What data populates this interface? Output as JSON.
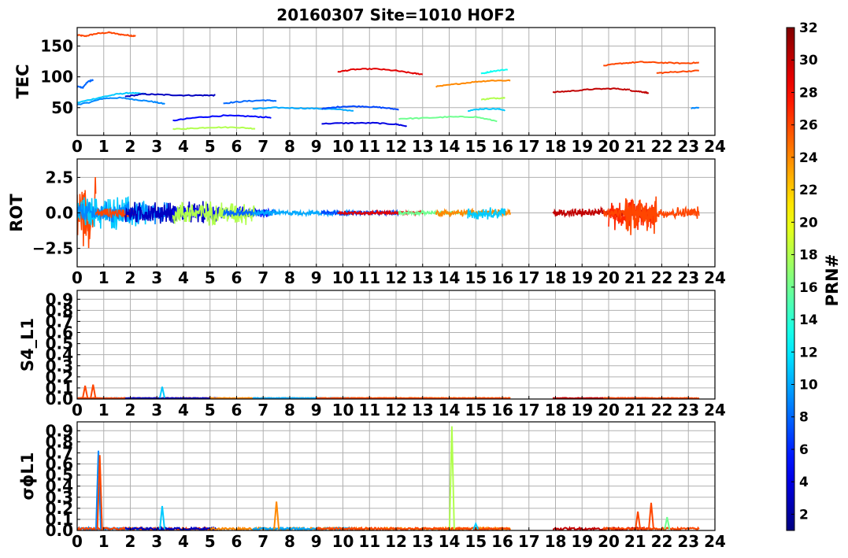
{
  "chart_data": {
    "title": "20160307 Site=1010 HOF2",
    "type": "line",
    "x_ticks": [
      "0",
      "1",
      "2",
      "3",
      "4",
      "5",
      "6",
      "7",
      "8",
      "9",
      "10",
      "11",
      "12",
      "13",
      "14",
      "15",
      "16",
      "17",
      "18",
      "19",
      "20",
      "21",
      "22",
      "23",
      "24"
    ],
    "xlim": [
      0,
      24
    ],
    "grid": true,
    "colorbar": {
      "label": "PRN#",
      "min": 1,
      "max": 32,
      "ticks": [
        "2",
        "4",
        "6",
        "8",
        "10",
        "12",
        "14",
        "16",
        "18",
        "20",
        "22",
        "24",
        "26",
        "28",
        "30",
        "32"
      ],
      "colormap": "jet"
    },
    "panels": [
      {
        "ylabel": "TEC",
        "ylim": [
          5,
          180
        ],
        "yticks": [
          {
            "v": 50,
            "t": "50"
          },
          {
            "v": 100,
            "t": "100"
          },
          {
            "v": 150,
            "t": "150"
          }
        ],
        "series": [
          {
            "prn": 26,
            "points": [
              [
                0.0,
                168
              ],
              [
                0.3,
                166
              ],
              [
                0.7,
                170
              ],
              [
                1.2,
                172
              ],
              [
                1.6,
                169
              ],
              [
                2.0,
                167
              ],
              [
                2.2,
                166
              ]
            ]
          },
          {
            "prn": 8,
            "points": [
              [
                0.0,
                85
              ],
              [
                0.2,
                82
              ],
              [
                0.4,
                92
              ],
              [
                0.6,
                95
              ]
            ]
          },
          {
            "prn": 9,
            "points": [
              [
                0.0,
                55
              ],
              [
                0.4,
                58
              ],
              [
                1.0,
                65
              ],
              [
                1.6,
                66
              ],
              [
                2.2,
                63
              ],
              [
                2.8,
                60
              ],
              [
                3.3,
                56
              ]
            ]
          },
          {
            "prn": 11,
            "points": [
              [
                0.0,
                58
              ],
              [
                0.8,
                66
              ],
              [
                1.5,
                72
              ],
              [
                2.0,
                74
              ],
              [
                2.6,
                72
              ]
            ]
          },
          {
            "prn": 3,
            "points": [
              [
                1.8,
                68
              ],
              [
                2.5,
                72
              ],
              [
                3.2,
                71
              ],
              [
                4.0,
                70
              ],
              [
                4.8,
                70
              ],
              [
                5.2,
                70
              ]
            ]
          },
          {
            "prn": 5,
            "points": [
              [
                3.6,
                29
              ],
              [
                4.5,
                34
              ],
              [
                5.5,
                37
              ],
              [
                6.5,
                36
              ],
              [
                7.3,
                34
              ]
            ]
          },
          {
            "prn": 18,
            "points": [
              [
                3.6,
                15
              ],
              [
                4.2,
                16
              ],
              [
                5.0,
                18
              ],
              [
                6.0,
                18
              ],
              [
                6.7,
                16
              ]
            ]
          },
          {
            "prn": 8,
            "points": [
              [
                5.5,
                57
              ],
              [
                6.2,
                60
              ],
              [
                7.0,
                62
              ],
              [
                7.5,
                61
              ]
            ]
          },
          {
            "prn": 10,
            "points": [
              [
                6.6,
                48
              ],
              [
                7.5,
                50
              ],
              [
                8.5,
                49
              ],
              [
                9.5,
                48
              ],
              [
                10.4,
                45
              ]
            ]
          },
          {
            "prn": 7,
            "points": [
              [
                9.2,
                48
              ],
              [
                10.0,
                52
              ],
              [
                10.8,
                52
              ],
              [
                11.5,
                50
              ],
              [
                12.1,
                47
              ]
            ]
          },
          {
            "prn": 4,
            "points": [
              [
                9.2,
                24
              ],
              [
                10.2,
                25
              ],
              [
                11.2,
                25
              ],
              [
                12.0,
                23
              ],
              [
                12.4,
                20
              ]
            ]
          },
          {
            "prn": 29,
            "points": [
              [
                9.8,
                108
              ],
              [
                10.4,
                112
              ],
              [
                11.2,
                113
              ],
              [
                12.0,
                110
              ],
              [
                12.6,
                106
              ],
              [
                13.0,
                104
              ]
            ]
          },
          {
            "prn": 16,
            "points": [
              [
                12.1,
                32
              ],
              [
                13.0,
                33
              ],
              [
                14.0,
                35
              ],
              [
                15.0,
                35
              ],
              [
                15.8,
                28
              ]
            ]
          },
          {
            "prn": 24,
            "points": [
              [
                13.5,
                84
              ],
              [
                14.2,
                88
              ],
              [
                15.0,
                92
              ],
              [
                15.6,
                94
              ],
              [
                16.3,
                94
              ]
            ]
          },
          {
            "prn": 13,
            "points": [
              [
                15.2,
                105
              ],
              [
                15.6,
                109
              ],
              [
                16.2,
                112
              ]
            ]
          },
          {
            "prn": 18,
            "points": [
              [
                15.2,
                63
              ],
              [
                15.6,
                65
              ],
              [
                16.1,
                66
              ]
            ]
          },
          {
            "prn": 11,
            "points": [
              [
                14.7,
                45
              ],
              [
                15.2,
                48
              ],
              [
                15.8,
                48
              ],
              [
                16.1,
                46
              ]
            ]
          },
          {
            "prn": 30,
            "points": [
              [
                17.9,
                75
              ],
              [
                18.6,
                77
              ],
              [
                19.4,
                80
              ],
              [
                20.2,
                81
              ],
              [
                20.8,
                79
              ]
            ]
          },
          {
            "prn": 30,
            "points": [
              [
                20.8,
                78
              ],
              [
                21.2,
                76
              ],
              [
                21.5,
                74
              ]
            ]
          },
          {
            "prn": 26,
            "points": [
              [
                19.8,
                118
              ],
              [
                20.5,
                122
              ],
              [
                21.2,
                124
              ],
              [
                22.0,
                123
              ],
              [
                22.8,
                122
              ],
              [
                23.4,
                123
              ]
            ]
          },
          {
            "prn": 26,
            "points": [
              [
                21.8,
                106
              ],
              [
                22.5,
                108
              ],
              [
                23.4,
                110
              ]
            ]
          },
          {
            "prn": 9,
            "points": [
              [
                23.1,
                49
              ],
              [
                23.4,
                50
              ]
            ]
          }
        ]
      },
      {
        "ylabel": "ROT",
        "ylim": [
          -3.8,
          3.8
        ],
        "yticks": [
          {
            "v": -2.5,
            "t": "−2.5"
          },
          {
            "v": 0,
            "t": "0.0"
          },
          {
            "v": 2.5,
            "t": "2.5"
          }
        ]
      },
      {
        "ylabel": "S4_L1",
        "ylim": [
          0,
          0.98
        ],
        "yticks": [
          {
            "v": 0,
            "t": "0.0"
          },
          {
            "v": 0.1,
            "t": "0.1"
          },
          {
            "v": 0.2,
            "t": "0.2"
          },
          {
            "v": 0.3,
            "t": "0.3"
          },
          {
            "v": 0.4,
            "t": "0.4"
          },
          {
            "v": 0.5,
            "t": "0.5"
          },
          {
            "v": 0.6,
            "t": "0.6"
          },
          {
            "v": 0.7,
            "t": "0.7"
          },
          {
            "v": 0.8,
            "t": "0.8"
          },
          {
            "v": 0.9,
            "t": "0.9"
          }
        ],
        "spikes": [
          {
            "prn": 26,
            "x": 0.3,
            "y": 0.12
          },
          {
            "prn": 26,
            "x": 0.6,
            "y": 0.13
          },
          {
            "prn": 11,
            "x": 3.2,
            "y": 0.11
          }
        ]
      },
      {
        "ylabel": "σϕL1",
        "ylim": [
          0,
          0.98
        ],
        "yticks": [
          {
            "v": 0,
            "t": "0.0"
          },
          {
            "v": 0.1,
            "t": "0.1"
          },
          {
            "v": 0.2,
            "t": "0.2"
          },
          {
            "v": 0.3,
            "t": "0.3"
          },
          {
            "v": 0.4,
            "t": "0.4"
          },
          {
            "v": 0.5,
            "t": "0.5"
          },
          {
            "v": 0.6,
            "t": "0.6"
          },
          {
            "v": 0.7,
            "t": "0.7"
          },
          {
            "v": 0.8,
            "t": "0.8"
          },
          {
            "v": 0.9,
            "t": "0.9"
          }
        ],
        "spikes": [
          {
            "prn": 9,
            "x": 0.8,
            "y": 0.72
          },
          {
            "prn": 26,
            "x": 0.85,
            "y": 0.68
          },
          {
            "prn": 11,
            "x": 3.2,
            "y": 0.22
          },
          {
            "prn": 24,
            "x": 7.5,
            "y": 0.26
          },
          {
            "prn": 18,
            "x": 14.1,
            "y": 0.94
          },
          {
            "prn": 11,
            "x": 15.0,
            "y": 0.06
          },
          {
            "prn": 26,
            "x": 21.1,
            "y": 0.17
          },
          {
            "prn": 26,
            "x": 21.6,
            "y": 0.25
          },
          {
            "prn": 16,
            "x": 22.2,
            "y": 0.12
          }
        ]
      }
    ]
  }
}
